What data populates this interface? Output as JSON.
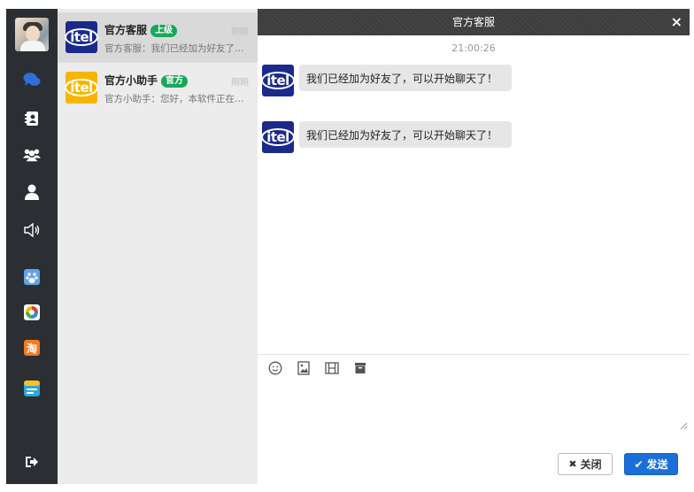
{
  "sidebar": {
    "icons": [
      "chat-icon",
      "contacts-book-icon",
      "group-icon",
      "user-icon",
      "speaker-icon",
      "baidu-paw-icon",
      "qq-news-icon",
      "taobao-icon",
      "notes-app-icon",
      "logout-icon"
    ]
  },
  "conversations": [
    {
      "name": "官方客服",
      "badge": "上级",
      "time": "刚刚",
      "preview": "官方客服：我们已经加为好友了，可以开始聊天了！",
      "logo": "itel",
      "logo_color": "#1a2a8c"
    },
    {
      "name": "官方小助手",
      "badge": "官方",
      "time": "刚刚",
      "preview": "官方小助手：您好，本软件正在测试中",
      "logo": "itel",
      "logo_color": "#f7b500"
    }
  ],
  "chat": {
    "title": "官方客服",
    "close_symbol": "×",
    "timestamp": "21:00:26",
    "messages": [
      {
        "sender_logo": "itel",
        "text": "我们已经加为好友了，可以开始聊天了！"
      },
      {
        "sender_logo": "itel",
        "text": "我们已经加为好友了，可以开始聊天了！"
      }
    ],
    "toolbar": [
      "emoji-icon",
      "image-icon",
      "video-icon",
      "folder-icon"
    ],
    "buttons": {
      "close": "关闭",
      "send": "发送"
    }
  },
  "colors": {
    "rail": "#2b2e33",
    "header": "#3d3d3d",
    "badge": "#19a85a",
    "send": "#1b6fd8",
    "active_chat_icon": "#2f6fd6"
  }
}
